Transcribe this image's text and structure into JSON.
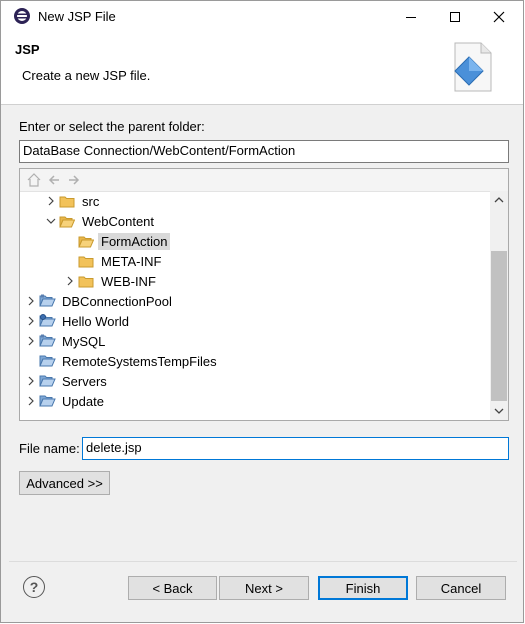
{
  "window": {
    "title": "New JSP File"
  },
  "banner": {
    "title": "JSP",
    "subtitle": "Create a new JSP file."
  },
  "folder": {
    "label": "Enter or select the parent folder:",
    "value": "DataBase Connection/WebContent/FormAction"
  },
  "tree": {
    "items": [
      {
        "label": "src",
        "icon": "folder-icon",
        "expander": "collapsed"
      },
      {
        "label": "WebContent",
        "icon": "folder-open-icon",
        "expander": "expanded"
      },
      {
        "label": "FormAction",
        "icon": "folder-open-icon",
        "expander": "none",
        "selected": true
      },
      {
        "label": "META-INF",
        "icon": "folder-icon",
        "expander": "none"
      },
      {
        "label": "WEB-INF",
        "icon": "folder-icon",
        "expander": "collapsed"
      },
      {
        "label": "DBConnectionPool",
        "icon": "project-folder-icon",
        "expander": "collapsed"
      },
      {
        "label": "Hello World",
        "icon": "web-project-icon",
        "expander": "collapsed"
      },
      {
        "label": "MySQL",
        "icon": "project-folder-icon",
        "expander": "collapsed"
      },
      {
        "label": "RemoteSystemsTempFiles",
        "icon": "project-folder-icon",
        "expander": "none"
      },
      {
        "label": "Servers",
        "icon": "project-folder-icon",
        "expander": "collapsed"
      },
      {
        "label": "Update",
        "icon": "project-folder-icon",
        "expander": "collapsed"
      }
    ]
  },
  "filename": {
    "label": "File name:",
    "value": "delete.jsp"
  },
  "buttons": {
    "advanced": "Advanced >>",
    "back": "< Back",
    "next": "Next >",
    "finish": "Finish",
    "cancel": "Cancel",
    "help": "?"
  },
  "colors": {
    "accent": "#0078d7",
    "folder": "#f2c25a",
    "selection": "#d9d9d9"
  }
}
